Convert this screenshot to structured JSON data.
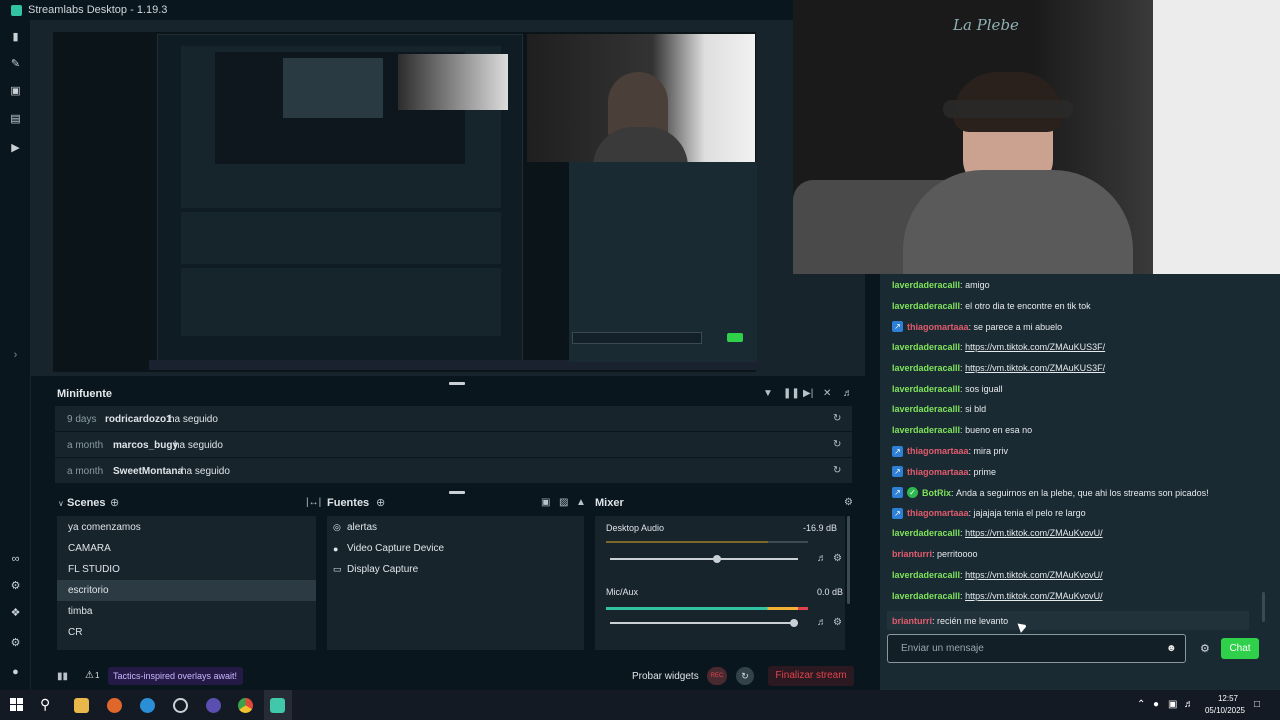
{
  "app": {
    "title": "Streamlabs Desktop - 1.19.3"
  },
  "colors": {
    "accent": "#31c3a2",
    "bg": "#09161d",
    "panel": "#17242c",
    "danger": "#e0434f",
    "chat_green": "#7fe35a",
    "chat_pink": "#e25b6c"
  },
  "activity": {
    "title": "Minifuente",
    "items": [
      {
        "time": "9 days",
        "user": "rodricardozo1",
        "action": "ha seguido"
      },
      {
        "time": "a month",
        "user": "marcos_bugy",
        "action": "ha seguido"
      },
      {
        "time": "a month",
        "user": "SweetMontana",
        "action": "ha seguido"
      }
    ]
  },
  "scenes": {
    "title": "Scenes",
    "items": [
      "ya comenzamos",
      "CAMARA",
      "FL STUDIO",
      "escritorio",
      "timba",
      "CR"
    ],
    "selected": "escritorio"
  },
  "sources": {
    "title": "Fuentes",
    "items": [
      {
        "label": "alertas",
        "icon": "globe-icon"
      },
      {
        "label": "Video Capture Device",
        "icon": "camera-icon"
      },
      {
        "label": "Display Capture",
        "icon": "monitor-icon"
      }
    ]
  },
  "mixer": {
    "title": "Mixer",
    "channels": [
      {
        "name": "Desktop Audio",
        "db": "-16.9 dB",
        "level": 0.8
      },
      {
        "name": "Mic/Aux",
        "db": "0.0 dB",
        "level": 1.0
      }
    ]
  },
  "footer": {
    "alert_count": "1",
    "promo": "Tactics-inspired overlays await!",
    "test_widgets": "Probar widgets",
    "rec": "REC",
    "end_stream": "Finalizar stream"
  },
  "chat": {
    "messages": [
      {
        "user": "laverdaderacalll",
        "text": "amigo",
        "color": "green"
      },
      {
        "user": "laverdaderacalll",
        "text": "el otro dia te encontre en tik tok",
        "color": "green"
      },
      {
        "user": "thiagomartaaa",
        "text": "se parece a mi abuelo",
        "color": "pink",
        "badge": true
      },
      {
        "user": "laverdaderacalll",
        "text": "https://vm.tiktok.com/ZMAuKUS3F/",
        "color": "green",
        "link": true
      },
      {
        "user": "laverdaderacalll",
        "text": "https://vm.tiktok.com/ZMAuKUS3F/",
        "color": "green",
        "link": true
      },
      {
        "user": "laverdaderacalll",
        "text": "sos iguall",
        "color": "green"
      },
      {
        "user": "laverdaderacalll",
        "text": "si bld",
        "color": "green"
      },
      {
        "user": "laverdaderacalll",
        "text": "bueno en esa no",
        "color": "green"
      },
      {
        "user": "thiagomartaaa",
        "text": "mira priv",
        "color": "pink",
        "badge": true
      },
      {
        "user": "thiagomartaaa",
        "text": "prime",
        "color": "pink",
        "badge": true
      },
      {
        "user": "BotRix",
        "text": "Anda a seguirnos en la plebe, que ahi los streams son picados!",
        "color": "green",
        "badge": true,
        "verified": true
      },
      {
        "user": "thiagomartaaa",
        "text": "jajajaja tenia el pelo re largo",
        "color": "pink",
        "badge": true
      },
      {
        "user": "laverdaderacalll",
        "text": "https://vm.tiktok.com/ZMAuKvovU/",
        "color": "green",
        "link": true
      },
      {
        "user": "brianturri",
        "text": "perritoooo",
        "color": "pink"
      },
      {
        "user": "laverdaderacalll",
        "text": "https://vm.tiktok.com/ZMAuKvovU/",
        "color": "green",
        "link": true
      },
      {
        "user": "laverdaderacalll",
        "text": "https://vm.tiktok.com/ZMAuKvovU/",
        "color": "green",
        "link": true
      },
      {
        "user": "brianturri",
        "text": "recién me levanto",
        "color": "pink"
      }
    ],
    "input_placeholder": "Enviar un mensaje",
    "send_label": "Chat"
  },
  "webcam": {
    "wall_text": "La Plebe"
  },
  "taskbar": {
    "time": "12:57",
    "date": "05/10/2025"
  }
}
